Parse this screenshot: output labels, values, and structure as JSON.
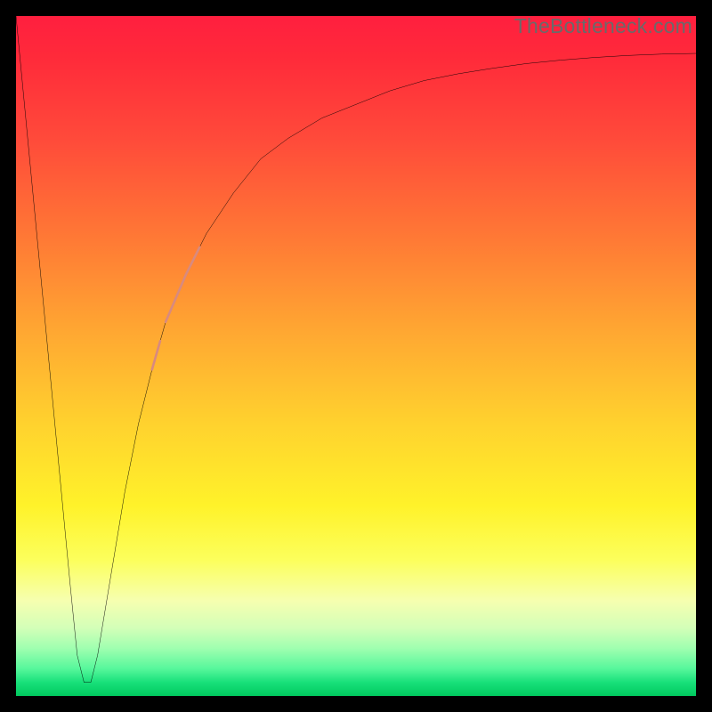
{
  "watermark": {
    "text": "TheBottleneck.com"
  },
  "colors": {
    "frame": "#000000",
    "curve": "#000000",
    "marker": "#d88a7f",
    "gradient_stops": [
      "#ff1f3f",
      "#ff4a3a",
      "#ff7a35",
      "#ffa632",
      "#ffd22e",
      "#fff22a",
      "#f6ffb0",
      "#9fffb0",
      "#18e07a",
      "#00c95e"
    ]
  },
  "chart_data": {
    "type": "line",
    "title": "",
    "xlabel": "",
    "ylabel": "",
    "xlim": [
      0,
      100
    ],
    "ylim": [
      0,
      100
    ],
    "grid": false,
    "legend": false,
    "series": [
      {
        "name": "bottleneck-curve",
        "x": [
          0,
          2,
          4,
          6,
          8,
          9,
          10,
          11,
          12,
          14,
          16,
          18,
          20,
          22,
          25,
          28,
          32,
          36,
          40,
          45,
          50,
          55,
          60,
          65,
          70,
          75,
          80,
          85,
          90,
          95,
          100
        ],
        "y": [
          100,
          79,
          58,
          37,
          16,
          6,
          2,
          2,
          6,
          18,
          30,
          40,
          48,
          55,
          62,
          68,
          74,
          79,
          82,
          85,
          87,
          89,
          90.5,
          91.5,
          92.3,
          93,
          93.5,
          93.9,
          94.2,
          94.4,
          94.5
        ]
      }
    ],
    "markers": [
      {
        "name": "highlight-upper",
        "shape": "pill",
        "x_range": [
          22,
          26
        ],
        "y_range": [
          55,
          65
        ]
      },
      {
        "name": "highlight-lower",
        "shape": "dot",
        "x": 21,
        "y": 52
      }
    ]
  }
}
